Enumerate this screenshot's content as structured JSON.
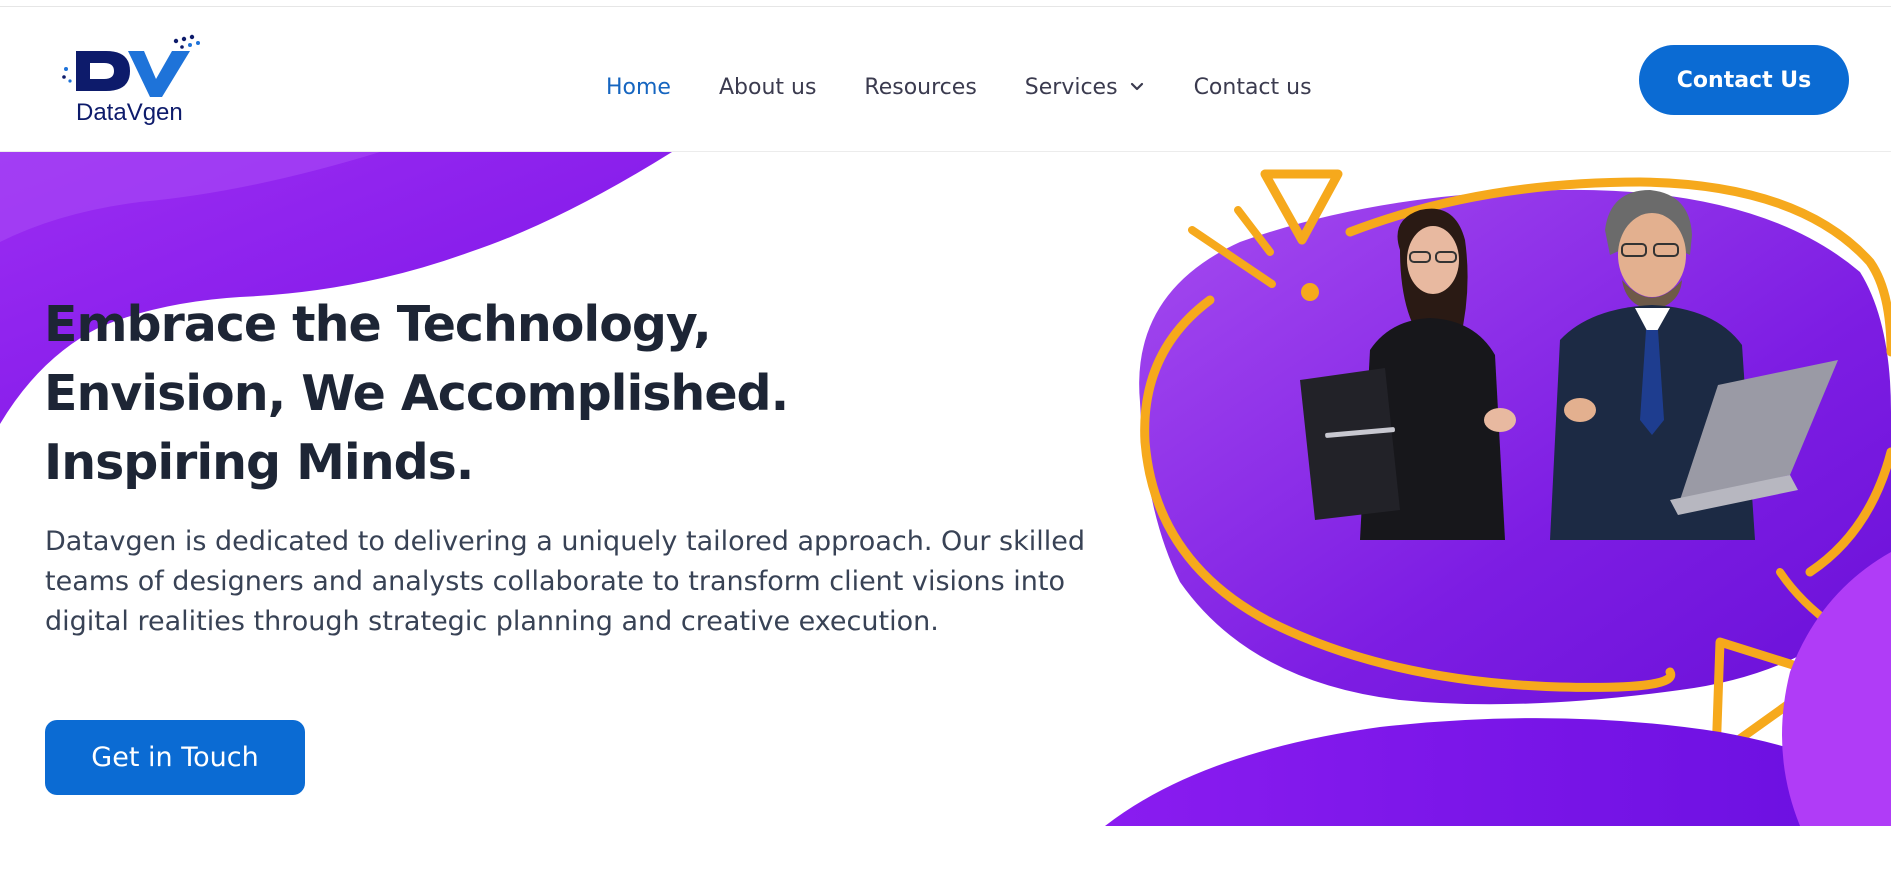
{
  "brand": {
    "name": "DataVgen",
    "logo_letters": "DV",
    "color_primary": "#0d1b6b",
    "color_accent": "#1e73d9"
  },
  "nav": {
    "items": [
      {
        "label": "Home",
        "active": true
      },
      {
        "label": "About us",
        "active": false
      },
      {
        "label": "Resources",
        "active": false
      },
      {
        "label": "Services",
        "active": false,
        "has_dropdown": true
      },
      {
        "label": "Contact us",
        "active": false
      }
    ],
    "cta_label": "Contact Us"
  },
  "hero": {
    "headline_lines": [
      "Embrace the Technology,",
      "Envision, We Accomplished.",
      "Inspiring Minds."
    ],
    "description": "Datavgen is dedicated to delivering a uniquely tailored approach. Our skilled teams of designers and analysts collaborate to transform client visions into digital realities through strategic planning and creative execution.",
    "cta_label": "Get in Touch"
  },
  "colors": {
    "button_blue": "#0b6bd3",
    "purple": "#8b1cf0",
    "purple_dark": "#6a0fe0",
    "orange": "#f6a91c",
    "active_link": "#1565c0"
  },
  "icons": {
    "services_dropdown": "chevron-down-icon"
  }
}
